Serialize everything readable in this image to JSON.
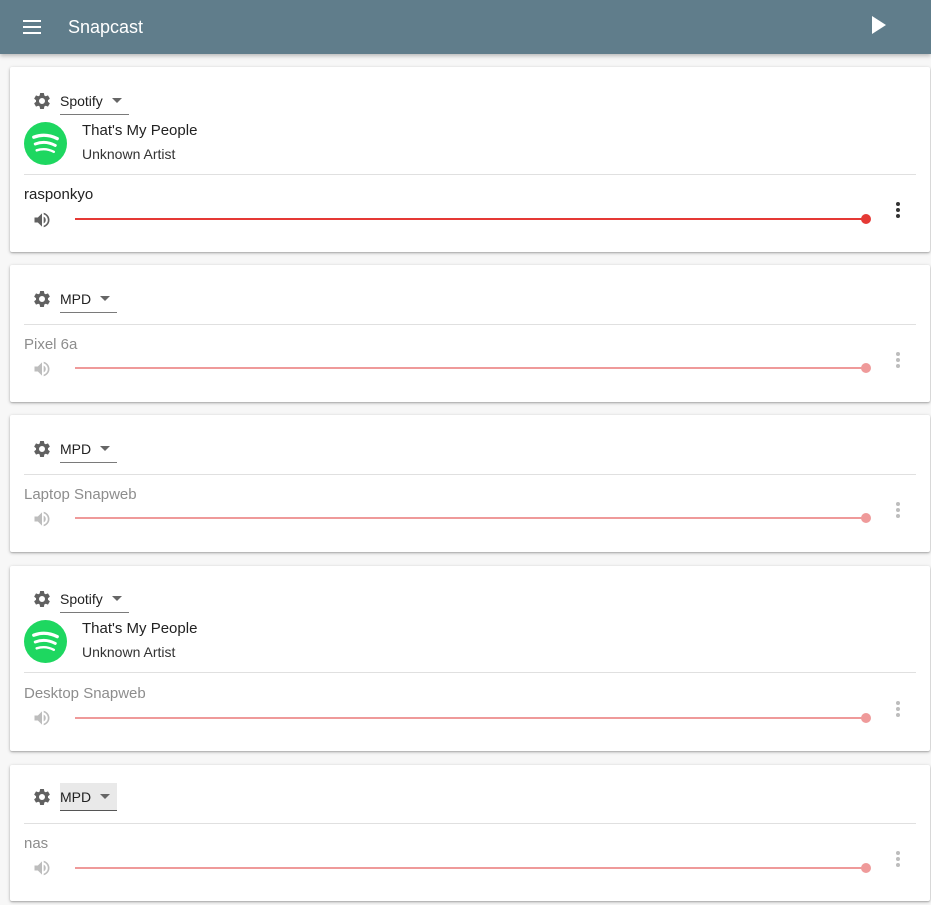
{
  "appbar": {
    "title": "Snapcast",
    "color": "#607d8b",
    "menu_icon": "menu-icon",
    "play_icon": "play-icon"
  },
  "groups": [
    {
      "stream": "Spotify",
      "track": {
        "title": "That's My People",
        "artist": "Unknown Artist"
      },
      "client": {
        "name": "rasponkyo",
        "connected": true,
        "volume_percent": 100
      }
    },
    {
      "stream": "MPD",
      "client": {
        "name": "Pixel 6a",
        "connected": false,
        "volume_percent": 100
      }
    },
    {
      "stream": "MPD",
      "client": {
        "name": "Laptop Snapweb",
        "connected": false,
        "volume_percent": 100
      }
    },
    {
      "stream": "Spotify",
      "track": {
        "title": "That's My People",
        "artist": "Unknown Artist"
      },
      "client": {
        "name": "Desktop Snapweb",
        "connected": false,
        "volume_percent": 100
      }
    },
    {
      "stream": "MPD",
      "client": {
        "name": "nas",
        "connected": false,
        "volume_percent": 100
      }
    }
  ],
  "colors": {
    "accent": "#e53935",
    "accent_disabled": "#ef9a9a",
    "spotify": "#1ed760"
  }
}
